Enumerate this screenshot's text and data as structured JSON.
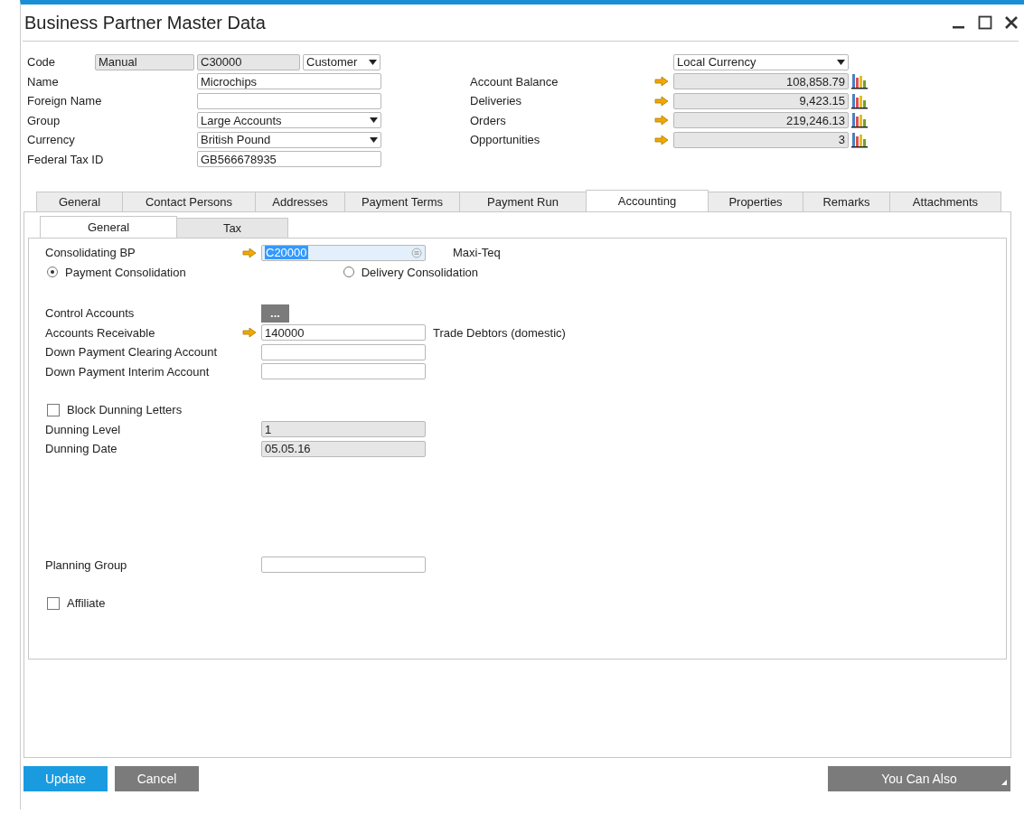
{
  "window": {
    "title": "Business Partner Master Data"
  },
  "header": {
    "code": {
      "label": "Code",
      "series": "Manual",
      "number": "C30000",
      "type": "Customer"
    },
    "fields": [
      {
        "label": "Name",
        "value": "Microchips",
        "kind": "text"
      },
      {
        "label": "Foreign Name",
        "kind": "text"
      },
      {
        "label": "Group",
        "value": "Large Accounts",
        "kind": "dropdown"
      },
      {
        "label": "Currency",
        "value": "British Pound",
        "kind": "dropdown"
      },
      {
        "label": "Federal Tax ID",
        "value": "GB566678935",
        "kind": "text"
      }
    ],
    "currency_view": "Local Currency",
    "balances": [
      {
        "label": "Account Balance",
        "value": "108,858.79"
      },
      {
        "label": "Deliveries",
        "value": "9,423.15"
      },
      {
        "label": "Orders",
        "value": "219,246.13"
      },
      {
        "label": "Opportunities",
        "value": "3"
      }
    ]
  },
  "tabs": [
    {
      "label": "General",
      "selected": false
    },
    {
      "label": "Contact Persons",
      "selected": false
    },
    {
      "label": "Addresses",
      "selected": false
    },
    {
      "label": "Payment Terms",
      "selected": false
    },
    {
      "label": "Payment Run",
      "selected": false
    },
    {
      "label": "Accounting",
      "selected": true
    },
    {
      "label": "Properties",
      "selected": false
    },
    {
      "label": "Remarks",
      "selected": false
    },
    {
      "label": "Attachments",
      "selected": false
    }
  ],
  "subtabs": [
    {
      "label": "General",
      "selected": true
    },
    {
      "label": "Tax",
      "selected": false
    }
  ],
  "accounting": {
    "consolidating_bp": {
      "label": "Consolidating BP",
      "value": "C20000",
      "name": "Maxi-Teq",
      "text_selected": true
    },
    "consolidation": [
      {
        "label": "Payment Consolidation",
        "selected": true
      },
      {
        "label": "Delivery Consolidation",
        "selected": false
      }
    ],
    "control_accounts": {
      "label": "Control Accounts",
      "button": "..."
    },
    "accounts": [
      {
        "label": "Accounts Receivable",
        "value": "140000",
        "description": "Trade Debtors (domestic)",
        "link": true
      },
      {
        "label": "Down Payment Clearing Account",
        "link": false
      },
      {
        "label": "Down Payment Interim Account",
        "link": false
      }
    ],
    "block_dunning": {
      "label": "Block Dunning Letters",
      "checked": false
    },
    "dunning": [
      {
        "label": "Dunning Level",
        "value": "1"
      },
      {
        "label": "Dunning Date",
        "value": "05.05.16"
      }
    ],
    "planning_group": {
      "label": "Planning Group"
    },
    "affiliate": {
      "label": "Affiliate",
      "checked": false
    }
  },
  "buttons": {
    "update": "Update",
    "cancel": "Cancel",
    "more": "You Can Also"
  }
}
